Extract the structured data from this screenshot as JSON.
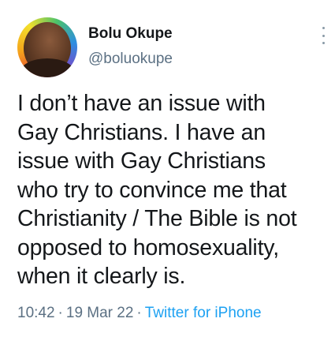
{
  "author": {
    "name": "Bolu Okupe",
    "handle": "@boluokupe"
  },
  "tweet": {
    "text": "I don’t have an issue with\nGay Christians. I have an\nissue with Gay Christians\nwho try to convince me that\nChristianity / The Bible is not\nopposed to homosexuality,\nwhen it clearly is."
  },
  "meta": {
    "time": "10:42",
    "date": "19 Mar 22",
    "separator": "·",
    "source": "Twitter for iPhone"
  },
  "colors": {
    "text": "#14171a",
    "secondary": "#5b7083",
    "link": "#1da1f2"
  },
  "icons": {
    "more": "more-vertical-icon"
  }
}
